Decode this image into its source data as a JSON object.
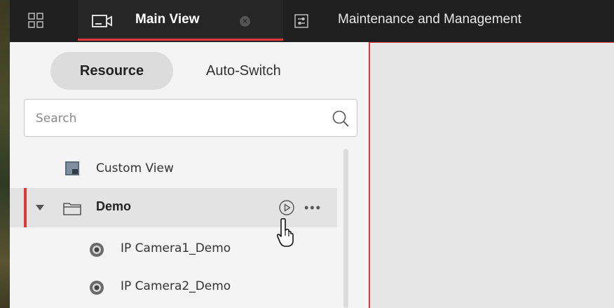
{
  "window": {
    "tabs": [
      {
        "label": "Main View",
        "active": true,
        "icon": "camera-view-icon"
      },
      {
        "label": "Maintenance and Management",
        "active": false,
        "icon": "settings-sliders-icon"
      }
    ],
    "menu_icon": "grid-menu-icon"
  },
  "panel": {
    "segments": {
      "resource": "Resource",
      "auto_switch": "Auto-Switch"
    },
    "search": {
      "placeholder": "Search",
      "value": ""
    },
    "tree": {
      "custom_view": "Custom View",
      "group": {
        "label": "Demo",
        "expanded": true
      },
      "cameras": [
        "IP Camera1_Demo",
        "IP Camera2_Demo"
      ]
    }
  },
  "colors": {
    "accent": "#e0353b",
    "topbar": "#1f1f1f",
    "panel": "#f4f4f4",
    "viewport": "#e6e6e6"
  }
}
